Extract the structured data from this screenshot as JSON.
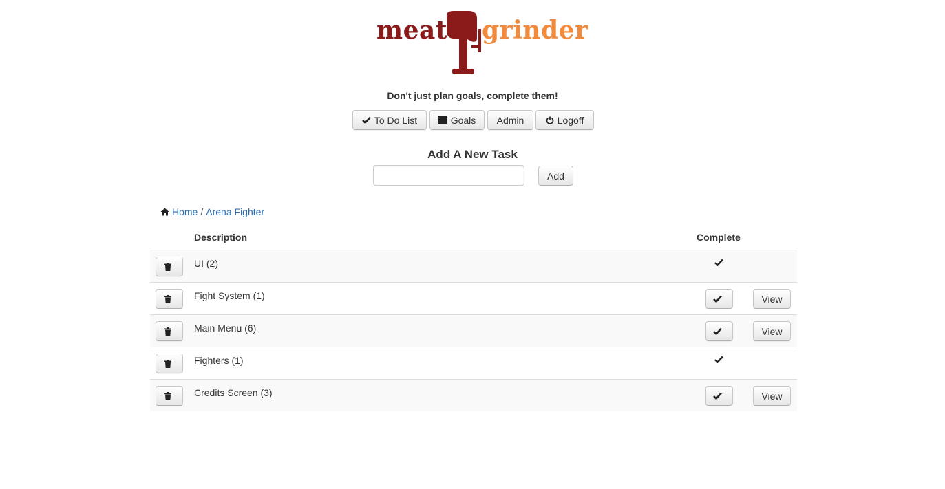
{
  "brand": {
    "word_left": "meat",
    "word_right": "grinder",
    "colors": {
      "dark_red": "#8b1a1a",
      "orange": "#f08a3c"
    },
    "logo_icon": "meat-grinder-icon"
  },
  "tagline": "Don't just plan goals, complete them!",
  "nav": [
    {
      "label": "To Do List",
      "icon": "check-icon"
    },
    {
      "label": "Goals",
      "icon": "list-icon"
    },
    {
      "label": "Admin",
      "icon": ""
    },
    {
      "label": "Logoff",
      "icon": "power-icon"
    }
  ],
  "add_task": {
    "heading": "Add A New Task",
    "input_value": "",
    "button_label": "Add"
  },
  "breadcrumb": {
    "home_icon": "home-icon",
    "home_label": "Home",
    "separator": "/",
    "current_label": "Arena Fighter",
    "link_color": "#2a6fb5"
  },
  "table": {
    "columns": [
      "Description",
      "Complete"
    ],
    "rows": [
      {
        "description": "UI (2)",
        "complete_display": "checkmark",
        "has_view": false
      },
      {
        "description": "Fight System (1)",
        "complete_display": "button",
        "has_view": true,
        "view_label": "View"
      },
      {
        "description": "Main Menu (6)",
        "complete_display": "button",
        "has_view": true,
        "view_label": "View"
      },
      {
        "description": "Fighters (1)",
        "complete_display": "checkmark",
        "has_view": false
      },
      {
        "description": "Credits Screen (3)",
        "complete_display": "button",
        "has_view": true,
        "view_label": "View"
      }
    ]
  }
}
